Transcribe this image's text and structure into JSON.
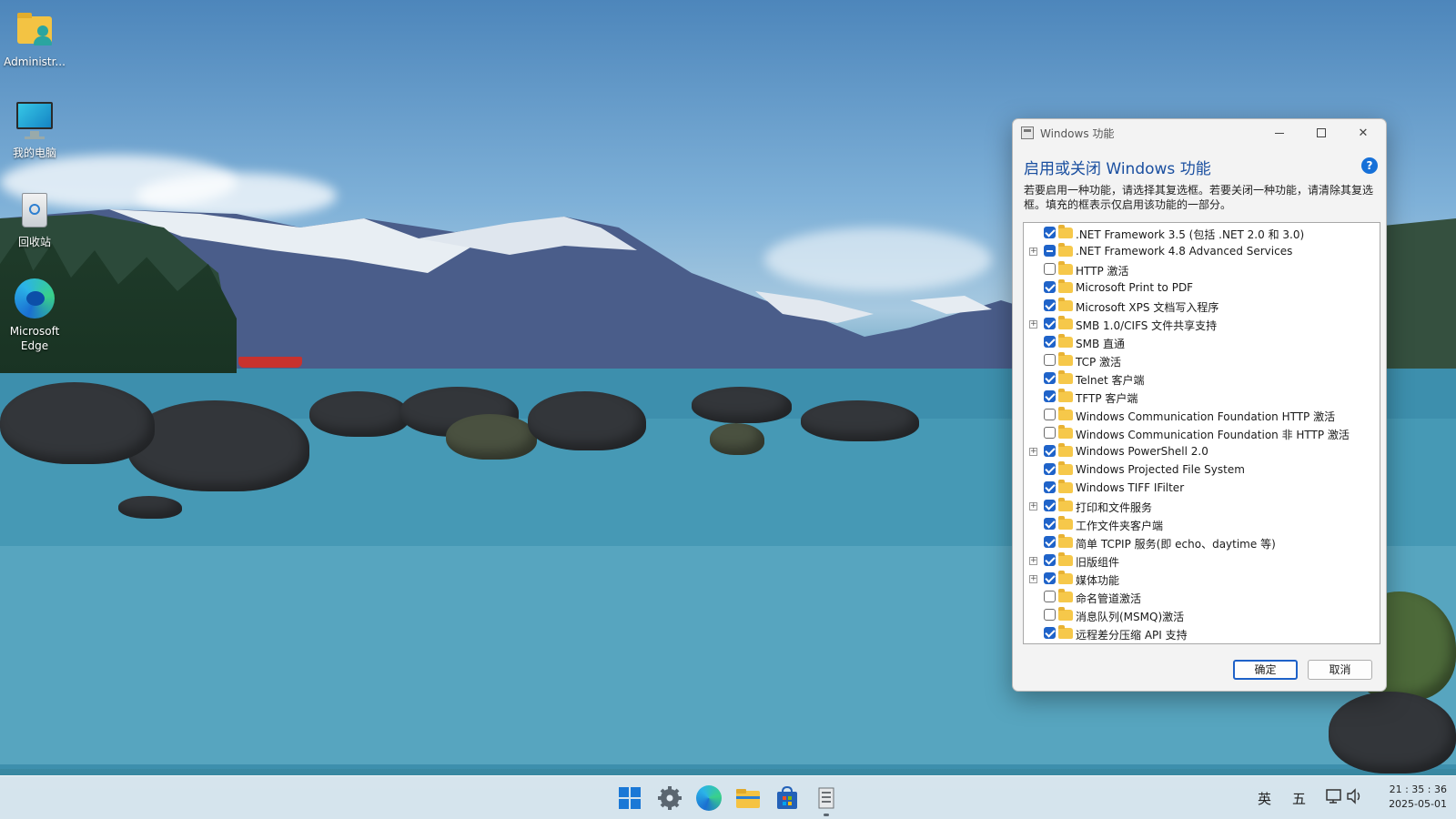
{
  "desktop": {
    "icons": [
      {
        "label": "Administr..."
      },
      {
        "label": "我的电脑"
      },
      {
        "label": "回收站"
      },
      {
        "label": "Microsoft Edge"
      }
    ]
  },
  "dialog": {
    "window_title": "Windows 功能",
    "heading": "启用或关闭 Windows 功能",
    "help_glyph": "?",
    "description": "若要启用一种功能，请选择其复选框。若要关闭一种功能，请清除其复选框。填充的框表示仅启用该功能的一部分。",
    "features": [
      {
        "label": ".NET Framework 3.5 (包括 .NET 2.0 和 3.0)",
        "state": "checked",
        "expandable": false
      },
      {
        "label": ".NET Framework 4.8 Advanced Services",
        "state": "partial",
        "expandable": true
      },
      {
        "label": "HTTP 激活",
        "state": "unchecked",
        "expandable": false
      },
      {
        "label": "Microsoft Print to PDF",
        "state": "checked",
        "expandable": false
      },
      {
        "label": "Microsoft XPS 文档写入程序",
        "state": "checked",
        "expandable": false
      },
      {
        "label": "SMB 1.0/CIFS 文件共享支持",
        "state": "checked",
        "expandable": true
      },
      {
        "label": "SMB 直通",
        "state": "checked",
        "expandable": false
      },
      {
        "label": "TCP 激活",
        "state": "unchecked",
        "expandable": false
      },
      {
        "label": "Telnet 客户端",
        "state": "checked",
        "expandable": false
      },
      {
        "label": "TFTP 客户端",
        "state": "checked",
        "expandable": false
      },
      {
        "label": "Windows Communication Foundation HTTP 激活",
        "state": "unchecked",
        "expandable": false
      },
      {
        "label": "Windows Communication Foundation 非 HTTP 激活",
        "state": "unchecked",
        "expandable": false
      },
      {
        "label": "Windows PowerShell 2.0",
        "state": "checked",
        "expandable": true
      },
      {
        "label": "Windows Projected File System",
        "state": "checked",
        "expandable": false
      },
      {
        "label": "Windows TIFF IFilter",
        "state": "checked",
        "expandable": false
      },
      {
        "label": "打印和文件服务",
        "state": "checked",
        "expandable": true
      },
      {
        "label": "工作文件夹客户端",
        "state": "checked",
        "expandable": false
      },
      {
        "label": "简单 TCPIP 服务(即 echo、daytime 等)",
        "state": "checked",
        "expandable": false
      },
      {
        "label": "旧版组件",
        "state": "checked",
        "expandable": true
      },
      {
        "label": "媒体功能",
        "state": "checked",
        "expandable": true
      },
      {
        "label": "命名管道激活",
        "state": "unchecked",
        "expandable": false
      },
      {
        "label": "消息队列(MSMQ)激活",
        "state": "unchecked",
        "expandable": false
      },
      {
        "label": "远程差分压缩 API 支持",
        "state": "checked",
        "expandable": false
      }
    ],
    "ok_label": "确定",
    "cancel_label": "取消"
  },
  "taskbar": {
    "apps": [
      "start-icon",
      "settings-icon",
      "edge-icon",
      "file-explorer-icon",
      "store-icon",
      "windows-features-icon"
    ],
    "ime_language": "英",
    "ime_mode": "五",
    "time": "21 : 35 : 36",
    "date": "2025-05-01"
  },
  "colors": {
    "accent": "#1f63c9",
    "heading": "#1a4fa0"
  }
}
